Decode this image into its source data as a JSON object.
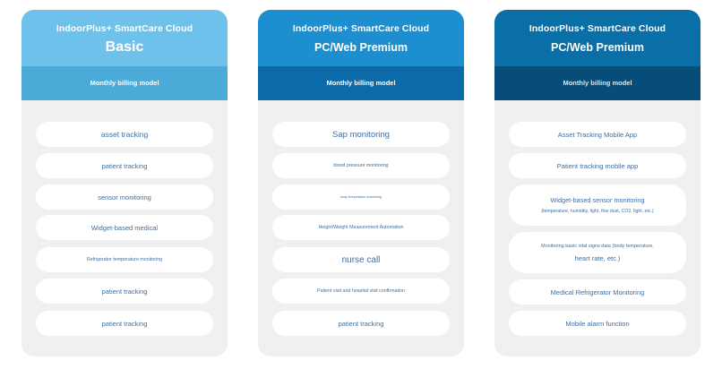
{
  "cards": [
    {
      "brand": "IndoorPlus+ SmartCare Cloud",
      "plan": "Basic",
      "billing": "Monthly billing model",
      "items": [
        {
          "text": "asset tracking"
        },
        {
          "text": "patient tracking"
        },
        {
          "text": "sensor monitoring"
        },
        {
          "text": "Widget-based medical"
        },
        {
          "text": "Refrigerator temperature monitoring"
        },
        {
          "text": "patient tracking"
        },
        {
          "text": "patient tracking"
        }
      ]
    },
    {
      "brand": "IndoorPlus+ SmartCare Cloud",
      "plan": "PC/Web Premium",
      "billing": "Monthly billing model",
      "items": [
        {
          "text": "Sap monitoring"
        },
        {
          "text": "blood pressure monitoring"
        },
        {
          "text": "body temperature monitoring"
        },
        {
          "text": "Height/Weight Measurement Automation"
        },
        {
          "text": "nurse call"
        },
        {
          "text": "Patient visit and hospital visit confirmation"
        },
        {
          "text": "patient tracking"
        }
      ]
    },
    {
      "brand": "IndoorPlus+ SmartCare Cloud",
      "plan": "PC/Web Premium",
      "billing": "Monthly billing model",
      "items": [
        {
          "text": "Asset Tracking Mobile App"
        },
        {
          "text": "Patient tracking mobile app"
        },
        {
          "text": "Widget-based sensor monitoring",
          "sub": "(temperature, humidity, light, fine dust, CO2, light, etc.)"
        },
        {
          "text": "Monitoring basic vital signs data (body temperature,",
          "sub": "heart rate, etc.)"
        },
        {
          "text": "Medical Refrigerator Monitoring"
        },
        {
          "text": "Mobile alarm function"
        }
      ]
    }
  ]
}
